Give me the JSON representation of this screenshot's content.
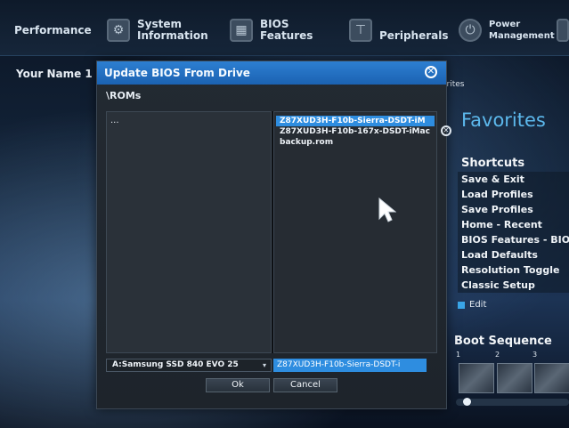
{
  "tabs": [
    {
      "label": "Performance",
      "icon": "performance-icon"
    },
    {
      "label": "System\nInformation",
      "icon": "gear-icon"
    },
    {
      "label": "BIOS\nFeatures",
      "icon": "chip-icon"
    },
    {
      "label": "Peripherals",
      "icon": "connector-icon"
    },
    {
      "label": "Power\nManagement",
      "icon": "power-icon"
    }
  ],
  "user_label": "Your Name 1",
  "favorites_tab": "orites",
  "dialog": {
    "title": "Update BIOS From Drive",
    "path": "\\ROMs",
    "dir_items": [
      "..."
    ],
    "files": [
      {
        "name": "Z87XUD3H-F10b-Sierra-DSDT-iM",
        "selected": true
      },
      {
        "name": "Z87XUD3H-F10b-167x-DSDT-iMac",
        "selected": false
      },
      {
        "name": "backup.rom",
        "selected": false
      }
    ],
    "drive": "A:Samsung SSD 840 EVO 25",
    "drive_arrow": "▾",
    "selected_file": "Z87XUD3H-F10b-Sierra-DSDT-i",
    "ok_label": "Ok",
    "cancel_label": "Cancel"
  },
  "favorites": {
    "title": "Favorites",
    "shortcuts_heading": "Shortcuts",
    "shortcuts": [
      "Save & Exit",
      "Load Profiles",
      "Save Profiles",
      "Home - Recent",
      "BIOS Features - BIOS",
      "Load Defaults",
      "Resolution Toggle",
      "Classic Setup"
    ],
    "edit_label": "Edit"
  },
  "boot": {
    "heading": "Boot Sequence",
    "numbers": [
      "1",
      "2",
      "3"
    ]
  },
  "colors": {
    "accent": "#2e8de0",
    "title_bar": "#1b62b2",
    "favorites_title": "#5cb8ec"
  }
}
